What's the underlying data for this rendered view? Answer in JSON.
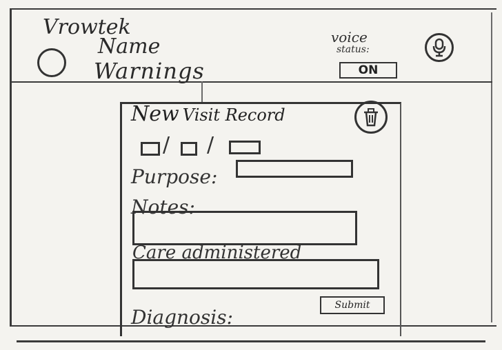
{
  "header": {
    "app_title": "Vrowtek",
    "user_name": "Name",
    "warnings": "Warnings",
    "voice_label": "voice",
    "voice_status_label": "status:",
    "voice_toggle_value": "ON"
  },
  "visit_record": {
    "title_part1": "New",
    "title_part2": "Visit Record",
    "date_separator": "/",
    "fields": {
      "purpose_label": "Purpose:",
      "notes_label": "Notes:",
      "care_label": "Care administered",
      "diagnosis_label": "Diagnosis:"
    },
    "submit_label": "Submit"
  },
  "icons": {
    "avatar": "user-avatar-icon",
    "mic": "microphone-icon",
    "trash": "trash-icon"
  }
}
